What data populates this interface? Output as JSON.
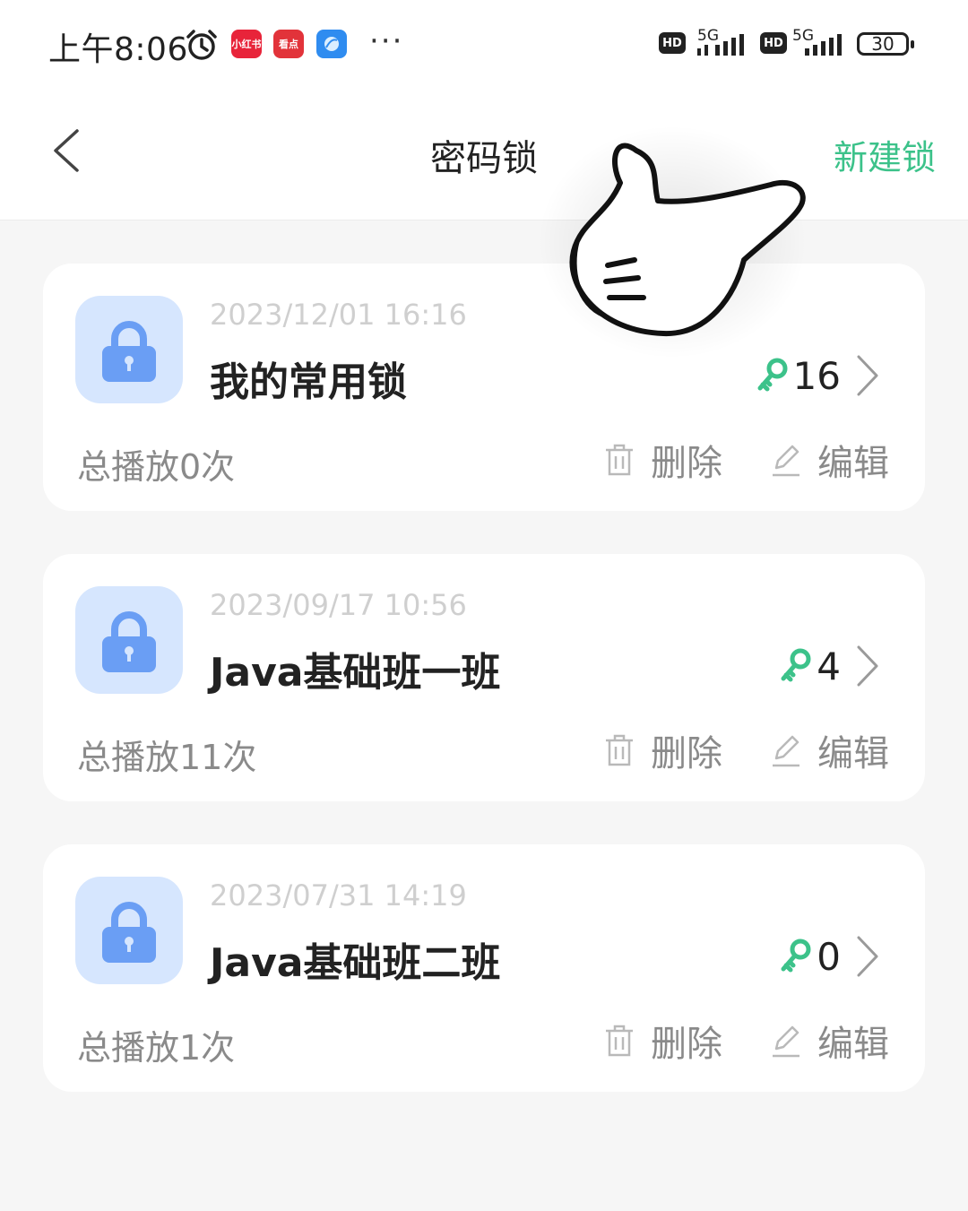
{
  "status_bar": {
    "time": "上午8:06",
    "apps": [
      {
        "icon": "xiaohongshu-icon",
        "label": "小红书",
        "color": "#e8243a"
      },
      {
        "icon": "kandian-icon",
        "label": "看点",
        "color": "#e2333a"
      },
      {
        "icon": "blue-app-icon",
        "label": "",
        "color": "#2f8cf0"
      }
    ],
    "more": "···",
    "sim1": {
      "hd": "HD",
      "net": "5G"
    },
    "sim2": {
      "hd": "HD",
      "net": "5G"
    },
    "battery": "30"
  },
  "header": {
    "title": "密码锁",
    "new_lock": "新建锁"
  },
  "locks": [
    {
      "date": "2023/12/01 16:16",
      "name": "我的常用锁",
      "keys": "16",
      "plays": "总播放0次",
      "delete": "删除",
      "edit": "编辑"
    },
    {
      "date": "2023/09/17 10:56",
      "name": "Java基础班一班",
      "keys": "4",
      "plays": "总播放11次",
      "delete": "删除",
      "edit": "编辑"
    },
    {
      "date": "2023/07/31 14:19",
      "name": "Java基础班二班",
      "keys": "0",
      "plays": "总播放1次",
      "delete": "删除",
      "edit": "编辑"
    }
  ],
  "colors": {
    "accent": "#3cc28a",
    "lock_tile": "#d6e6fe",
    "lock_icon": "#6a9ef4"
  }
}
